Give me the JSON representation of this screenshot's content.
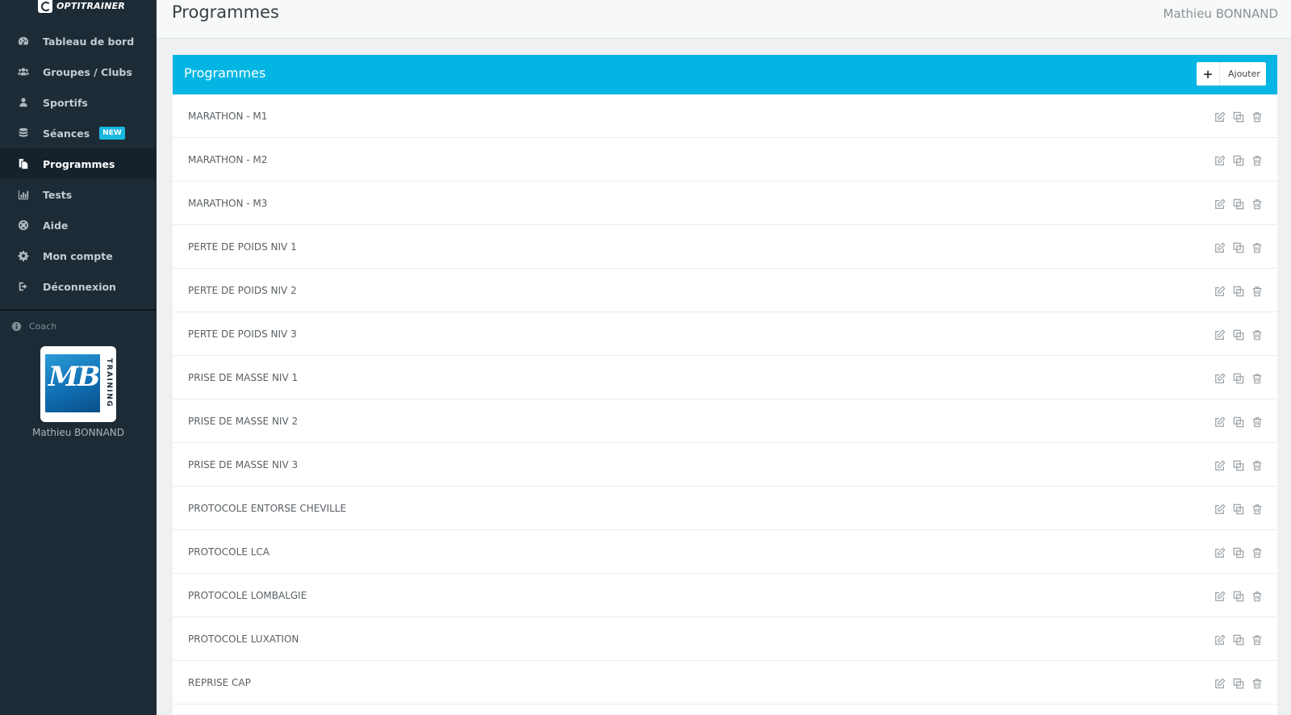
{
  "brand": {
    "name": "OPTITRAINER"
  },
  "sidebar": {
    "items": [
      {
        "label": "Tableau de bord",
        "icon": "dashboard-icon"
      },
      {
        "label": "Groupes / Clubs",
        "icon": "users-icon"
      },
      {
        "label": "Sportifs",
        "icon": "user-icon"
      },
      {
        "label": "Séances",
        "icon": "database-icon",
        "badge": "NEW"
      },
      {
        "label": "Programmes",
        "icon": "copy-icon",
        "active": true
      },
      {
        "label": "Tests",
        "icon": "bar-chart-icon"
      },
      {
        "label": "Aide",
        "icon": "life-ring-icon"
      },
      {
        "label": "Mon compte",
        "icon": "gear-icon"
      },
      {
        "label": "Déconnexion",
        "icon": "sign-out-icon"
      }
    ],
    "coach_label": "Coach",
    "coach_name": "Mathieu BONNAND",
    "avatar_text": {
      "mb": "MB",
      "training": "TRAINING"
    }
  },
  "header": {
    "title": "Programmes",
    "user": "Mathieu BONNAND"
  },
  "panel": {
    "title": "Programmes",
    "add_label": "Ajouter",
    "rows": [
      "MARATHON - M1",
      "MARATHON - M2",
      "MARATHON - M3",
      "PERTE DE POIDS NIV 1",
      "PERTE DE POIDS NIV 2",
      "PERTE DE POIDS NIV 3",
      "PRISE DE MASSE NIV 1",
      "PRISE DE MASSE NIV 2",
      "PRISE DE MASSE NIV 3",
      "PROTOCOLE ENTORSE CHEVILLE",
      "PROTOCOLE LCA",
      "PROTOCOLE LOMBALGIE",
      "PROTOCOLE LUXATION",
      "REPRISE CAP"
    ]
  },
  "colors": {
    "sidebar_bg": "#1d2b36",
    "accent": "#02b5e3",
    "badge": "#17b7e0"
  }
}
